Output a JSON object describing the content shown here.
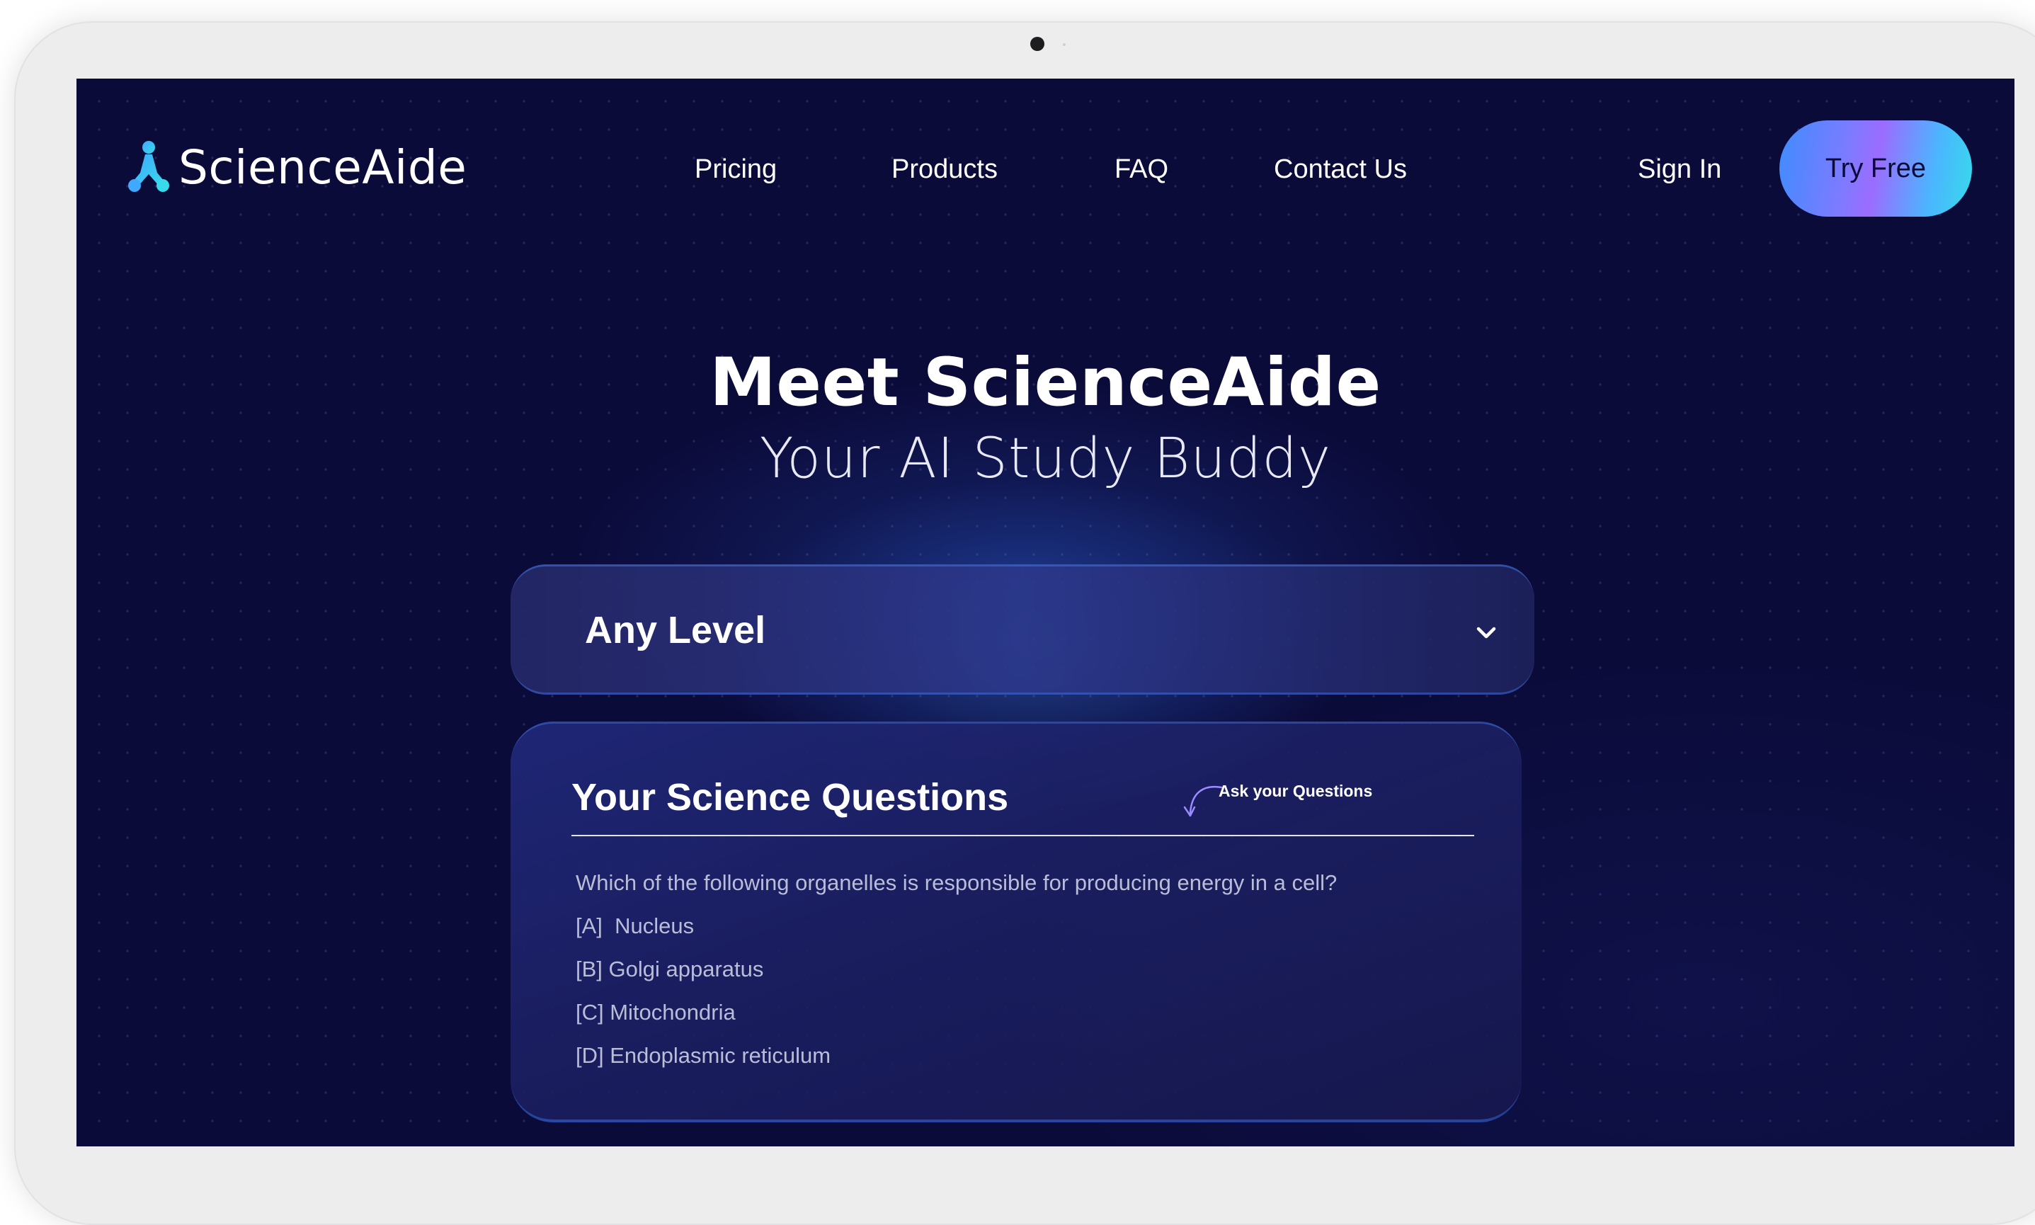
{
  "brand": {
    "name": "ScienceAide",
    "logo_colors": [
      "#3fa9ff",
      "#38d9ea"
    ]
  },
  "nav": {
    "links": [
      "Pricing",
      "Products",
      "FAQ",
      "Contact Us"
    ],
    "sign_in": "Sign In",
    "cta": "Try Free"
  },
  "hero": {
    "title": "Meet ScienceAide",
    "subtitle": "Your AI Study Buddy"
  },
  "level_select": {
    "value": "Any Level",
    "icon": "chevron-down-icon"
  },
  "questions": {
    "title": "Your Science Questions",
    "hint": "Ask your Questions",
    "hint_icon": "curved-arrow-icon",
    "question": "Which of the following organelles is responsible for producing energy in a cell?",
    "options": [
      "[A]  Nucleus",
      "[B] Golgi apparatus",
      "[C] Mitochondria",
      "[D] Endoplasmic reticulum"
    ]
  },
  "colors": {
    "background": "#0b0b3a",
    "cta_gradient": [
      "#3f8cff",
      "#9b6cff",
      "#37dbea"
    ],
    "text": "#ffffff",
    "muted_text": "#b9bdd8"
  }
}
